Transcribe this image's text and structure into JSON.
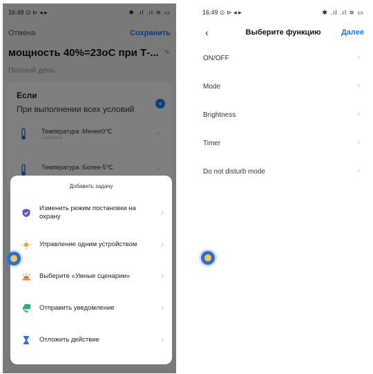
{
  "left": {
    "status": {
      "time": "16:48",
      "icons": "⊙ ⊳ ◂ ▸",
      "right": "✱ .ıl .ıl ≋ ▭"
    },
    "nav": {
      "cancel": "Отмена",
      "save": "Сохранить"
    },
    "title": "мощность 40%=23оС при Т-...",
    "subtitle": "Полный день",
    "if_title": "Если",
    "if_subtitle": "При выполнении всех условий",
    "conditions": [
      {
        "label": "Температура :Менее0℃",
        "small": "Термометр"
      },
      {
        "label": "Температура :Более-5℃",
        "small": ""
      }
    ],
    "sheet": {
      "title": "Добавить задачу",
      "items": [
        {
          "label": "Изменить режим постановки на охрану",
          "icon": "shield-icon",
          "color": "#6a4fc7"
        },
        {
          "label": "Управление одним устройством",
          "icon": "bulb-icon",
          "color": "#f3a825"
        },
        {
          "label": "Выберите «Умные сценарии»",
          "icon": "sunrise-icon",
          "color": "#f06a2a"
        },
        {
          "label": "Отправить уведомление",
          "icon": "message-icon",
          "color": "#23b36c"
        },
        {
          "label": "Отложить действие",
          "icon": "hourglass-icon",
          "color": "#2f6fd8"
        }
      ]
    }
  },
  "right": {
    "status": {
      "time": "16:49",
      "icons": "⊙ ⊳ ◂ ▸",
      "right": "✱ .ıl .ıl ≋ ▭"
    },
    "nav": {
      "back": "‹",
      "title": "Выберите функцию",
      "next": "Далее"
    },
    "functions": [
      {
        "label": "ON/OFF"
      },
      {
        "label": "Mode"
      },
      {
        "label": "Brightness"
      },
      {
        "label": "Timer"
      },
      {
        "label": "Do not disturb mode"
      }
    ]
  },
  "colors": {
    "accent": "#1e78ff"
  }
}
